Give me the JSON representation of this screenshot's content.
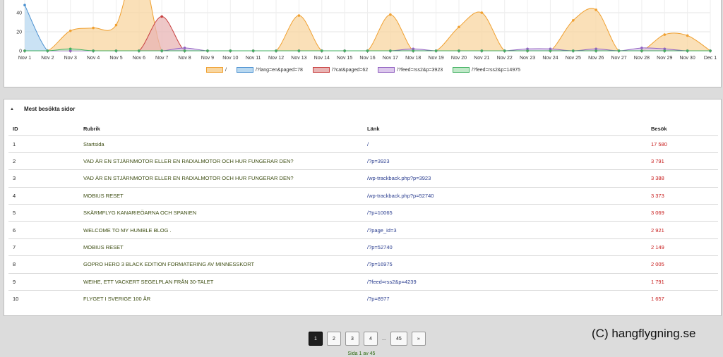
{
  "chart_data": {
    "type": "area",
    "title": "",
    "xlabel": "",
    "ylabel": "",
    "ylim": [
      0,
      80
    ],
    "yticks": [
      "0",
      "20",
      "40"
    ],
    "categories": [
      "Nov 1",
      "Nov 2",
      "Nov 3",
      "Nov 4",
      "Nov 5",
      "Nov 6",
      "Nov 7",
      "Nov 8",
      "Nov 9",
      "Nov 10",
      "Nov 11",
      "Nov 12",
      "Nov 13",
      "Nov 14",
      "Nov 15",
      "Nov 16",
      "Nov 17",
      "Nov 18",
      "Nov 19",
      "Nov 20",
      "Nov 21",
      "Nov 22",
      "Nov 23",
      "Nov 24",
      "Nov 25",
      "Nov 26",
      "Nov 27",
      "Nov 28",
      "Nov 29",
      "Nov 30",
      "Dec 1"
    ],
    "series": [
      {
        "name": "/",
        "color": "#f0a030",
        "fill": "#f8d6a0",
        "values": [
          0,
          0,
          21,
          24,
          27,
          95,
          0,
          0,
          0,
          0,
          0,
          0,
          37,
          0,
          0,
          0,
          38,
          0,
          0,
          25,
          40,
          0,
          0,
          0,
          32,
          43,
          0,
          0,
          17,
          16,
          0
        ]
      },
      {
        "name": "/?lang=en&paged=78",
        "color": "#4a90d0",
        "fill": "#b8d8f0",
        "values": [
          48,
          0,
          0,
          0,
          0,
          0,
          0,
          0,
          0,
          0,
          0,
          0,
          0,
          0,
          0,
          0,
          0,
          0,
          0,
          0,
          0,
          0,
          0,
          0,
          0,
          0,
          0,
          0,
          0,
          0,
          0
        ]
      },
      {
        "name": "/?cat&paged=62",
        "color": "#c84040",
        "fill": "#e8b4b4",
        "values": [
          0,
          0,
          0,
          0,
          0,
          0,
          36,
          0,
          0,
          0,
          0,
          0,
          0,
          0,
          0,
          0,
          0,
          0,
          0,
          0,
          0,
          0,
          0,
          0,
          0,
          0,
          0,
          0,
          0,
          0,
          0
        ]
      },
      {
        "name": "/?feed=rss2&p=3923",
        "color": "#9060c0",
        "fill": "#dcc8ec",
        "values": [
          0,
          0,
          0,
          0,
          0,
          0,
          0,
          3,
          0,
          0,
          0,
          0,
          0,
          0,
          0,
          0,
          0,
          2,
          0,
          0,
          0,
          0,
          2,
          2,
          0,
          2,
          0,
          3,
          2,
          0,
          0
        ]
      },
      {
        "name": "/?feed=rss2&p=14975",
        "color": "#40b060",
        "fill": "#c0e8c8",
        "values": [
          0,
          0,
          2,
          0,
          0,
          0,
          0,
          0,
          0,
          0,
          0,
          0,
          0,
          0,
          0,
          0,
          0,
          0,
          0,
          0,
          0,
          0,
          0,
          0,
          0,
          0,
          0,
          0,
          0,
          0,
          0
        ]
      }
    ]
  },
  "table": {
    "header": "Mest besökta sidor",
    "columns": {
      "id": "ID",
      "title": "Rubrik",
      "link": "Länk",
      "visits": "Besök"
    },
    "rows": [
      {
        "id": "1",
        "title": "Startsida",
        "link": "/",
        "visits": "17 580"
      },
      {
        "id": "2",
        "title": "VAD ÄR EN STJÄRNMOTOR ELLER EN RADIALMOTOR OCH HUR FUNGERAR DEN?",
        "link": "/?p=3923",
        "visits": "3 791"
      },
      {
        "id": "3",
        "title": "VAD ÄR EN STJÄRNMOTOR ELLER EN RADIALMOTOR OCH HUR FUNGERAR DEN?",
        "link": "/wp-trackback.php?p=3923",
        "visits": "3 388"
      },
      {
        "id": "4",
        "title": "MOBIUS RESET",
        "link": "/wp-trackback.php?p=52740",
        "visits": "3 373"
      },
      {
        "id": "5",
        "title": "SKÄRMFLYG KANARIEÖARNA OCH SPANIEN",
        "link": "/?p=10065",
        "visits": "3 069"
      },
      {
        "id": "6",
        "title": "WELCOME TO MY HUMBLE BLOG .",
        "link": "/?page_id=3",
        "visits": "2 921"
      },
      {
        "id": "7",
        "title": "MOBIUS RESET",
        "link": "/?p=52740",
        "visits": "2 149"
      },
      {
        "id": "8",
        "title": "GOPRO HERO 3 BLACK EDITION FORMATERING AV MINNESSKORT",
        "link": "/?p=16975",
        "visits": "2 005"
      },
      {
        "id": "9",
        "title": "WEIHE, ETT VACKERT SEGELPLAN FRÅN 30-TALET",
        "link": "/?feed=rss2&p=4239",
        "visits": "1 791"
      },
      {
        "id": "10",
        "title": "FLYGET I SVERIGE 100 ÅR",
        "link": "/?p=8977",
        "visits": "1 657"
      }
    ]
  },
  "pagination": {
    "pages": [
      "1",
      "2",
      "3",
      "4"
    ],
    "ellipsis": "...",
    "last": "45",
    "next": "»",
    "info": "Sida 1 av 45"
  },
  "watermark": "(C) hangflygning.se"
}
